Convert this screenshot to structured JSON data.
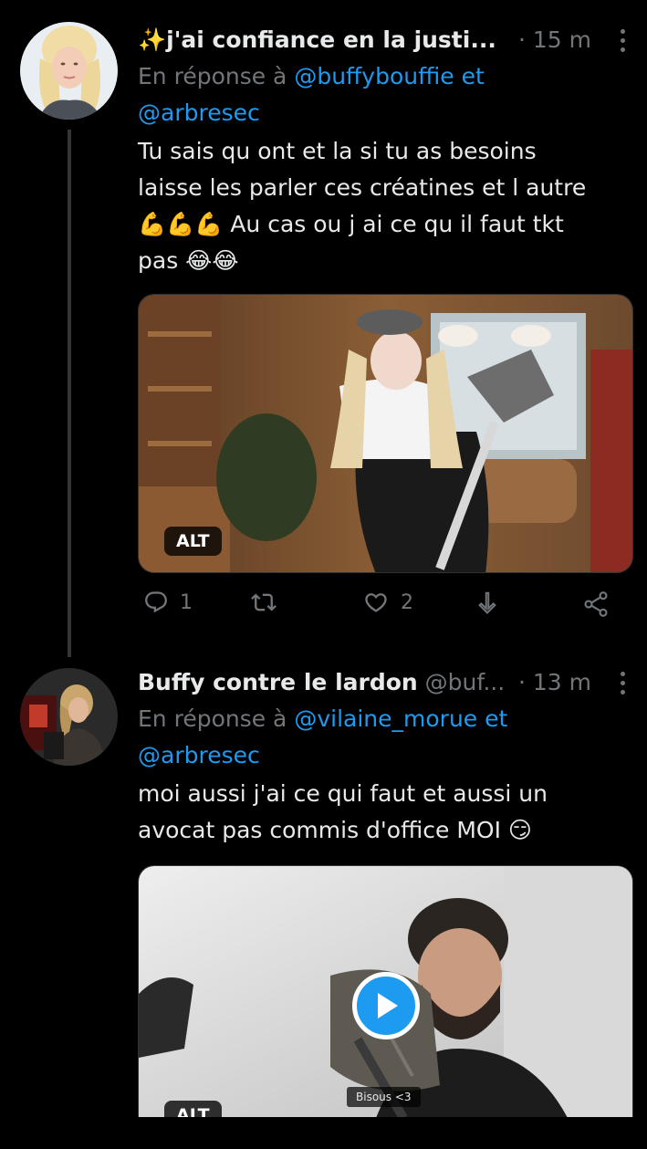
{
  "tweets": [
    {
      "display_name": "✨j'ai confiance en la justi...",
      "time": "· 15 m",
      "reply_prefix": "En réponse à",
      "mention_1": "@buffybouffie",
      "mention_joiner": "et",
      "mention_2": "@arbresec",
      "text_line_1": "Tu sais qu ont et la si tu as besoins",
      "text_line_2": "laisse les parler ces créatines et l autre",
      "text_line_3": "💪💪💪 Au cas ou j ai ce qu il faut tkt",
      "text_line_4": "pas 😂😂",
      "media_alt": "ALT",
      "reply_count": "1",
      "retweet_count": "",
      "like_count": "2"
    },
    {
      "display_name": "Buffy contre le lardon",
      "handle": "@buf...",
      "time": "· 13 m",
      "reply_prefix": "En réponse à",
      "mention_1": "@vilaine_morue",
      "mention_joiner": "et",
      "mention_2": "@arbresec",
      "text_line_1": "moi aussi j'ai ce qui faut et aussi un",
      "text_line_2": "avocat pas commis d'office MOI 😏",
      "media_alt": "ALT",
      "media_caption": "Bisous <3"
    }
  ],
  "icons": {
    "reply": "reply-icon",
    "retweet": "retweet-icon",
    "like": "heart-icon",
    "download": "download-icon",
    "share": "share-icon",
    "play": "play-icon",
    "more": "more-vertical-icon"
  },
  "colors": {
    "background": "#000000",
    "text": "#e7e9ea",
    "secondary": "#71767b",
    "accent": "#1d9bf0",
    "divider": "#2f3336"
  }
}
